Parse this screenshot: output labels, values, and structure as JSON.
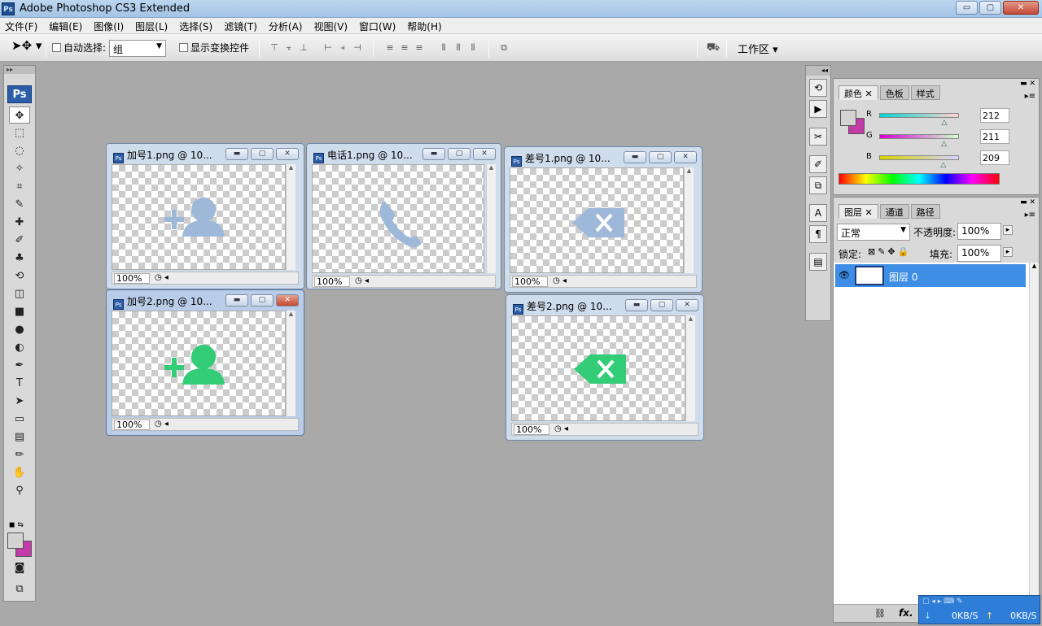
{
  "app": {
    "title": "Adobe Photoshop CS3 Extended",
    "logo_text": "Ps"
  },
  "window_controls": [
    "▭",
    "▢",
    "✕"
  ],
  "menu": [
    "文件(F)",
    "编辑(E)",
    "图像(I)",
    "图层(L)",
    "选择(S)",
    "滤镜(T)",
    "分析(A)",
    "视图(V)",
    "窗口(W)",
    "帮助(H)"
  ],
  "options_bar": {
    "auto_select_label": "自动选择:",
    "auto_select_value": "组",
    "show_transform_label": "显示变换控件",
    "workspace_label": "工作区 ▾"
  },
  "toolbox": {
    "badge": "Ps",
    "tools": [
      "move",
      "marquee",
      "lasso",
      "magic-wand",
      "crop",
      "slice",
      "healing",
      "brush",
      "stamp",
      "history-brush",
      "eraser",
      "gradient",
      "blur",
      "dodge",
      "pen",
      "type",
      "path-select",
      "shape",
      "notes",
      "eyedropper",
      "hand",
      "zoom"
    ],
    "tool_glyphs": [
      "✥",
      "⬚",
      "◌",
      "✧",
      "⌗",
      "✎",
      "✚",
      "✐",
      "♣",
      "⟲",
      "◫",
      "■",
      "●",
      "◐",
      "✒",
      "T",
      "➤",
      "▭",
      "▤",
      "✏",
      "✋",
      "⚲"
    ],
    "fg_color": "#d4d3d1",
    "bg_color": "#c43aa7"
  },
  "documents": [
    {
      "title": "加号1.png @ 10...",
      "zoom": "100%",
      "icon_color": "#9db8d8",
      "icon": "add-user"
    },
    {
      "title": "电话1.png @ 10...",
      "zoom": "100%",
      "icon_color": "#9db8d8",
      "icon": "phone"
    },
    {
      "title": "差号1.png @ 10...",
      "zoom": "100%",
      "icon_color": "#9db8d8",
      "icon": "delete"
    },
    {
      "title": "加号2.png @ 10...",
      "zoom": "100%",
      "icon_color": "#33cc77",
      "icon": "add-user"
    },
    {
      "title": "差号2.png @ 10...",
      "zoom": "100%",
      "icon_color": "#33cc77",
      "icon": "delete"
    }
  ],
  "color_panel": {
    "tabs": [
      "颜色",
      "色板",
      "样式"
    ],
    "channels": [
      {
        "label": "R",
        "value": "212",
        "level": 212
      },
      {
        "label": "G",
        "value": "211",
        "level": 211
      },
      {
        "label": "B",
        "value": "209",
        "level": 209
      }
    ]
  },
  "layers_panel": {
    "tabs": [
      "图层",
      "通道",
      "路径"
    ],
    "blend_mode": "正常",
    "opacity_label": "不透明度:",
    "opacity_value": "100%",
    "lock_label": "锁定:",
    "fill_label": "填充:",
    "fill_value": "100%",
    "layer_name": "图层 0",
    "fx_label": "fx."
  },
  "network": {
    "down": "0KB/S",
    "up": "0KB/S"
  }
}
